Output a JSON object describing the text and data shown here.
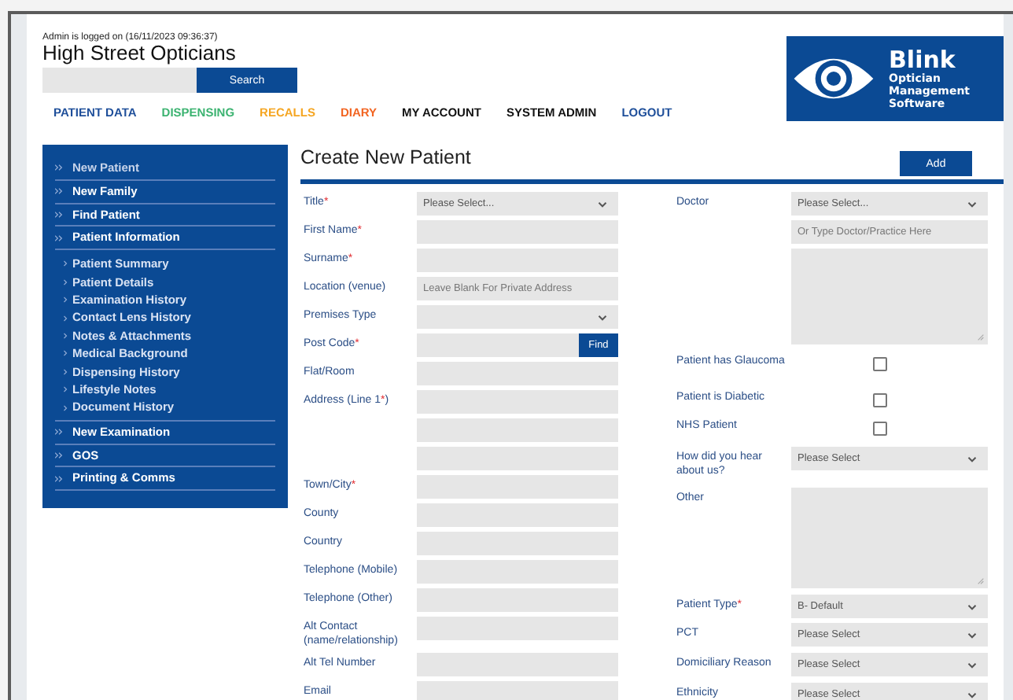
{
  "header": {
    "login_status": "Admin is logged on (16/11/2023 09:36:37)",
    "practice_name": "High Street Opticians",
    "search_button": "Search"
  },
  "logo": {
    "name": "Blink",
    "subtitle": "Optician Management Software"
  },
  "nav": [
    {
      "label": "PATIENT DATA",
      "color": "#1f4f9a"
    },
    {
      "label": "DISPENSING",
      "color": "#3cb371"
    },
    {
      "label": "RECALLS",
      "color": "#f5a623"
    },
    {
      "label": "DIARY",
      "color": "#f26522"
    },
    {
      "label": "MY ACCOUNT",
      "color": "#111111"
    },
    {
      "label": "SYSTEM ADMIN",
      "color": "#111111"
    },
    {
      "label": "LOGOUT",
      "color": "#1f4f9a"
    }
  ],
  "sidebar": {
    "items": [
      {
        "label": "New Patient",
        "muted": true
      },
      {
        "label": "New Family",
        "muted": false
      },
      {
        "label": "Find Patient",
        "muted": false
      },
      {
        "label": "Patient Information",
        "muted": false,
        "children": [
          {
            "label": "Patient Summary"
          },
          {
            "label": "Patient Details"
          },
          {
            "label": "Examination History"
          },
          {
            "label": "Contact Lens History"
          },
          {
            "label": "Notes & Attachments"
          },
          {
            "label": "Medical Background"
          },
          {
            "label": "Dispensing History"
          },
          {
            "label": "Lifestyle Notes"
          },
          {
            "label": "Document History"
          }
        ]
      },
      {
        "label": "New Examination",
        "muted": false
      },
      {
        "label": "GOS",
        "muted": false
      },
      {
        "label": "Printing & Comms",
        "muted": false
      }
    ]
  },
  "form": {
    "title": "Create New Patient",
    "add_button": "Add",
    "left_fields": [
      {
        "kind": "select",
        "label": "Title",
        "mark": "*",
        "value": "Please Select..."
      },
      {
        "kind": "text",
        "label": "First Name",
        "mark": "*"
      },
      {
        "kind": "text",
        "label": "Surname",
        "mark": "*"
      },
      {
        "kind": "text",
        "label": "Location (venue)",
        "placeholder": "Leave Blank For Private Address"
      },
      {
        "kind": "select",
        "label": "Premises Type"
      },
      {
        "kind": "postcode",
        "label": "Post Code",
        "mark": "*",
        "button": "Find"
      },
      {
        "kind": "text",
        "label": "Flat/Room"
      },
      {
        "kind": "text",
        "label": "Address (Line 1",
        "mark": "*",
        "label_after": ")"
      },
      {
        "kind": "text"
      },
      {
        "kind": "text"
      },
      {
        "kind": "text",
        "label": "Town/City",
        "mark": "*"
      },
      {
        "kind": "text",
        "label": "County"
      },
      {
        "kind": "text",
        "label": "Country"
      },
      {
        "kind": "text",
        "label": "Telephone (Mobile)"
      },
      {
        "kind": "text",
        "label": "Telephone (Other)"
      },
      {
        "kind": "text",
        "label": "Alt Contact (name/relationship)"
      },
      {
        "kind": "text",
        "label": "Alt Tel Number"
      },
      {
        "kind": "text",
        "label": "Email"
      }
    ],
    "right_fields": [
      {
        "kind": "select",
        "label": "Doctor",
        "value": "Please Select..."
      },
      {
        "kind": "text",
        "placeholder": "Or Type Doctor/Practice Here"
      },
      {
        "kind": "textarea"
      },
      {
        "kind": "checkbox",
        "label": "Patient has Glaucoma",
        "checked": false
      },
      {
        "kind": "checkbox",
        "label": "Patient is Diabetic",
        "checked": false
      },
      {
        "kind": "checkbox",
        "label": "NHS Patient",
        "checked": false
      },
      {
        "kind": "select",
        "label": "How did you hear about us?",
        "value": "Please Select"
      },
      {
        "kind": "textarea",
        "label": "Other"
      },
      {
        "kind": "select",
        "label": "Patient Type",
        "mark": "*",
        "value": "B- Default"
      },
      {
        "kind": "select",
        "label": "PCT",
        "value": "Please Select"
      },
      {
        "kind": "select",
        "label": "Domiciliary Reason",
        "value": "Please Select"
      },
      {
        "kind": "select",
        "label": "Ethnicity",
        "value": "Please Select"
      }
    ]
  }
}
